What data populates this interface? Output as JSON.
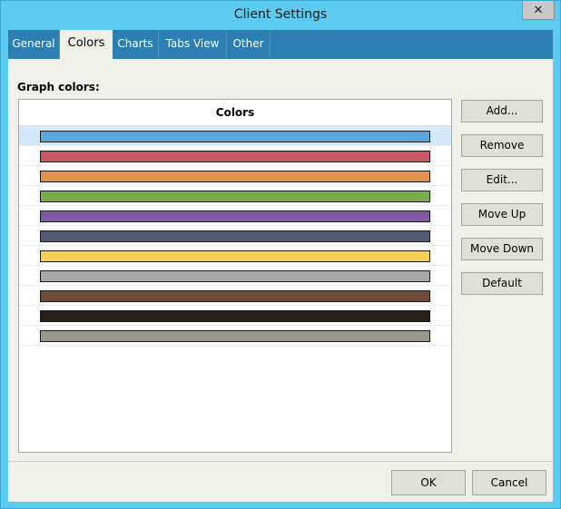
{
  "window": {
    "title": "Client Settings"
  },
  "tabs": [
    {
      "label": "General"
    },
    {
      "label": "Colors"
    },
    {
      "label": "Charts"
    },
    {
      "label": "Tabs View"
    },
    {
      "label": "Other"
    }
  ],
  "active_tab": "Colors",
  "graph_colors_label": "Graph colors:",
  "list": {
    "header": "Colors",
    "selected_index": 0,
    "colors": [
      "#5aa6df",
      "#cc5664",
      "#e29149",
      "#79ac4d",
      "#8058a4",
      "#555a74",
      "#f7cd5a",
      "#a8a8a8",
      "#704c38",
      "#272018",
      "#9a9890"
    ]
  },
  "buttons": {
    "add": "Add...",
    "remove": "Remove",
    "edit": "Edit...",
    "move_up": "Move Up",
    "move_down": "Move Down",
    "default": "Default"
  },
  "footer": {
    "ok": "OK",
    "cancel": "Cancel"
  },
  "icons": {
    "close": "close-icon"
  }
}
